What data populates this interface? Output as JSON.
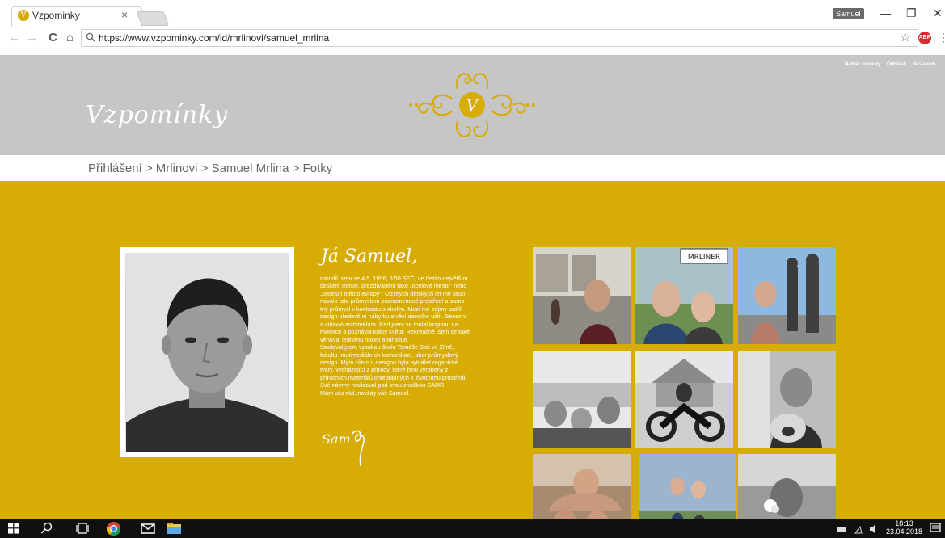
{
  "browser": {
    "tab_title": "Vzpominky",
    "tab_favicon_letter": "V",
    "tab_close": "×",
    "user_chip": "Samuel",
    "win_min": "—",
    "win_max": "❐",
    "win_close": "✕",
    "url": "https://www.vzpominky.com/id/mrlinovi/samuel_mrlina",
    "back": "←",
    "forward": "→",
    "reload": "C",
    "home": "⌂",
    "star": "☆",
    "ext_label": "ABP",
    "menu": "⋮"
  },
  "header": {
    "brand": "Vzpomínky",
    "logo_letter": "V",
    "links": [
      "Nahrát soubory",
      "Odhlásit",
      "Nastavení"
    ]
  },
  "breadcrumb": "Přihlášení  > Mrlinovi > Samuel Mrlina > Fotky",
  "profile": {
    "intro": "Já Samuel,",
    "bio_lines": [
      "narodil jsem se 4.5. 1996, 6:50 SEČ, ve třetím největším",
      "českém městě, přezdívaném také „ocelové město\" nebo",
      "„secesní město evropy\". Od mých dětských let mě fasci-",
      "novalo toto průmyslem poznamenané prostředí a samo-",
      "tný průmysl v kontrastu s okolím. Mezi mé zájmy patřil",
      "design především nábytku a věcí denního užití. Secesní",
      "a cihlová architektura. Rád jsem se toulal krajinou na",
      "motorce a poznával krásy světa. Rekreačně jsem se také",
      "věnoval lednímu hokeji a turistice.",
      "Studoval  jsem vysokou školu Tomáše Bati ve Zlíně,",
      "fakultu multimediálních komunikací, obor průmyslový",
      "design. Mým cílem v designu bylo vytvářet organické",
      "tvary, vycházející z přírody, které jsou vyrobeny z",
      "přírodních materiálů ohleduplných k životnímu prostředí.",
      "Své návrhy realizoval pod svou  značkou SAMR.",
      "Mám vás rád, navždy váš Samuel."
    ],
    "sign_sign": "Sam"
  },
  "gallery": {
    "sign_text": "MRLINER"
  },
  "taskbar": {
    "time": "18:13",
    "date": "23.04.2018"
  }
}
